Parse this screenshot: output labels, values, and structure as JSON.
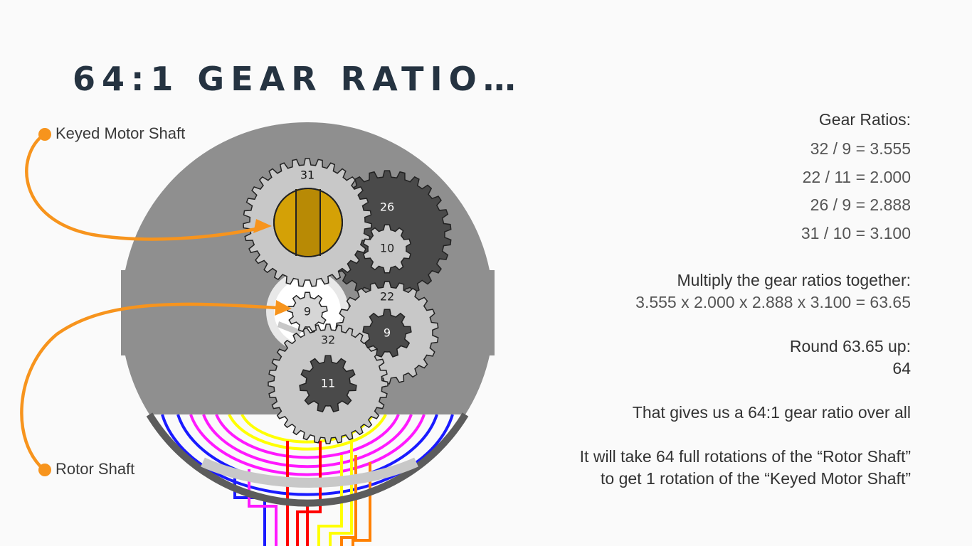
{
  "title": "64:1 GEAR RATIO…",
  "labels": {
    "keyed_motor_shaft": "Keyed Motor Shaft",
    "rotor_shaft": "Rotor Shaft"
  },
  "gears": {
    "g31": "31",
    "g26": "26",
    "g10": "10",
    "g9a": "9",
    "g22": "22",
    "g9b": "9",
    "g32": "32",
    "g11": "11"
  },
  "panel": {
    "heading": "Gear Ratios:",
    "ratios": [
      "32 / 9 = 3.555",
      "22 / 11 = 2.000",
      "26 / 9 = 2.888",
      "31 / 10 = 3.100"
    ],
    "multiply_heading": "Multiply the gear ratios together:",
    "multiply_result": "3.555 x 2.000 x 2.888 x 3.100 = 63.65",
    "round_heading": "Round 63.65 up:",
    "round_result": "64",
    "summary": "That gives us a 64:1 gear ratio over all",
    "conclusion_line1": "It will take 64 full rotations of the “Rotor Shaft”",
    "conclusion_line2": "to get 1 rotation of the “Keyed Motor Shaft”"
  },
  "colors": {
    "arrow": "#f7941d",
    "title": "#253341",
    "housing": "#8f8f8f",
    "gear_light": "#c8c8c8",
    "gear_dark": "#4a4a4a",
    "shaft": "#d4a106"
  }
}
